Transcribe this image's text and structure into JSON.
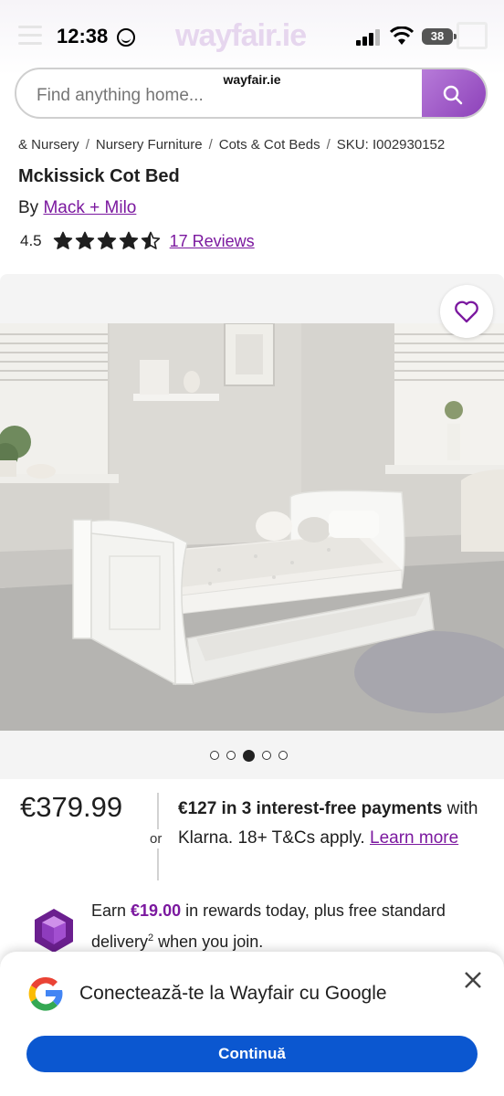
{
  "status_bar": {
    "time": "12:38",
    "battery": "38"
  },
  "browser": {
    "url": "wayfair.ie",
    "brand_watermark": "wayfair.ie"
  },
  "search": {
    "placeholder": "Find anything home..."
  },
  "breadcrumb": [
    "& Nursery",
    "Nursery Furniture",
    "Cots & Cot Beds",
    "SKU: I002930152"
  ],
  "product": {
    "title": "Mckissick Cot Bed",
    "by_label": "By",
    "brand": "Mack + Milo",
    "rating": "4.5",
    "rating_value": 4.5,
    "rating_max": 5,
    "reviews_label": "17 Reviews"
  },
  "gallery": {
    "image_count": 5,
    "active_index": 2
  },
  "price": {
    "amount": "€379.99",
    "or_label": "or",
    "klarna_bold": "€127 in 3 interest-free payments",
    "klarna_rest": " with Klarna. 18+ T&Cs apply. ",
    "learn_more": "Learn more"
  },
  "rewards": {
    "prefix": "Earn ",
    "amount": "€19.00",
    "middle": " in rewards today, plus free standard delivery",
    "sup": "2",
    "suffix": " when you join."
  },
  "google_prompt": {
    "title": "Conectează-te la Wayfair cu Google",
    "button": "Continuă"
  },
  "colors": {
    "brand_purple": "#7b189f",
    "google_blue": "#0b57d0",
    "search_button": "#9b4fc9"
  }
}
